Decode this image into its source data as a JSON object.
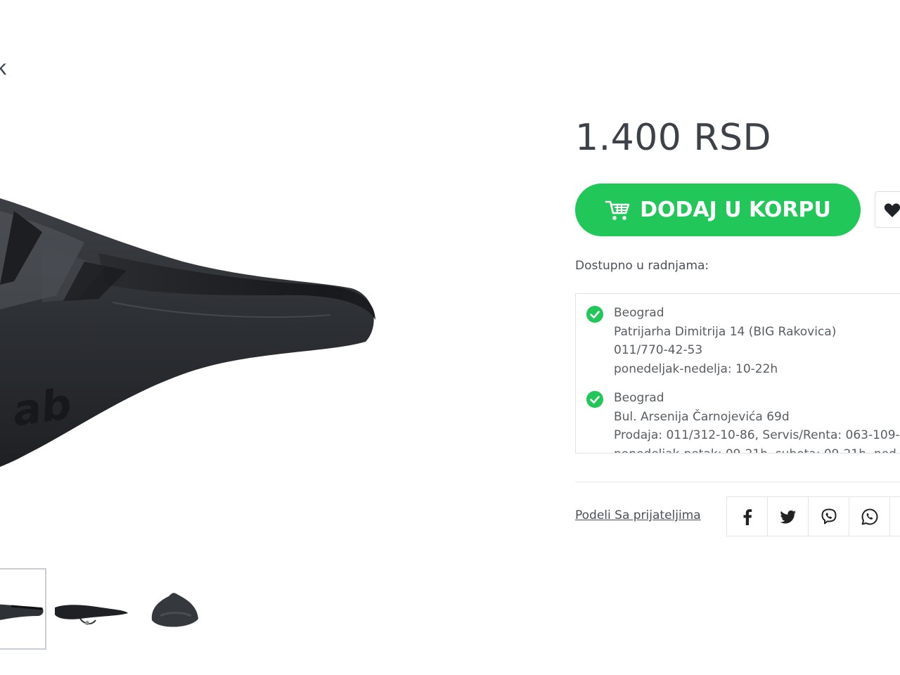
{
  "header": {
    "crumb_fragment": "k"
  },
  "product": {
    "price": "1.400 RSD",
    "add_to_cart_label": "DODAJ U KORPU",
    "brand_color": "#22c75a"
  },
  "availability": {
    "label": "Dostupno u radnjama:",
    "stores": [
      {
        "city": "Beograd",
        "address": "Patrijarha Dimitrija 14 (BIG Rakovica)",
        "phone": "011/770-42-53",
        "hours": "ponedeljak-nedelja: 10-22h"
      },
      {
        "city": "Beograd",
        "address": "Bul. Arsenija Čarnojevića 69d",
        "phone": "Prodaja: 011/312-10-86, Servis/Renta: 063-109-",
        "hours": "ponedeljak-petak: 09-21h, subota: 09-21h, ned"
      }
    ]
  },
  "share": {
    "label": "Podeli Sa prijateljima",
    "icons": [
      "facebook-icon",
      "twitter-icon",
      "viber-icon",
      "whatsapp-icon"
    ]
  }
}
